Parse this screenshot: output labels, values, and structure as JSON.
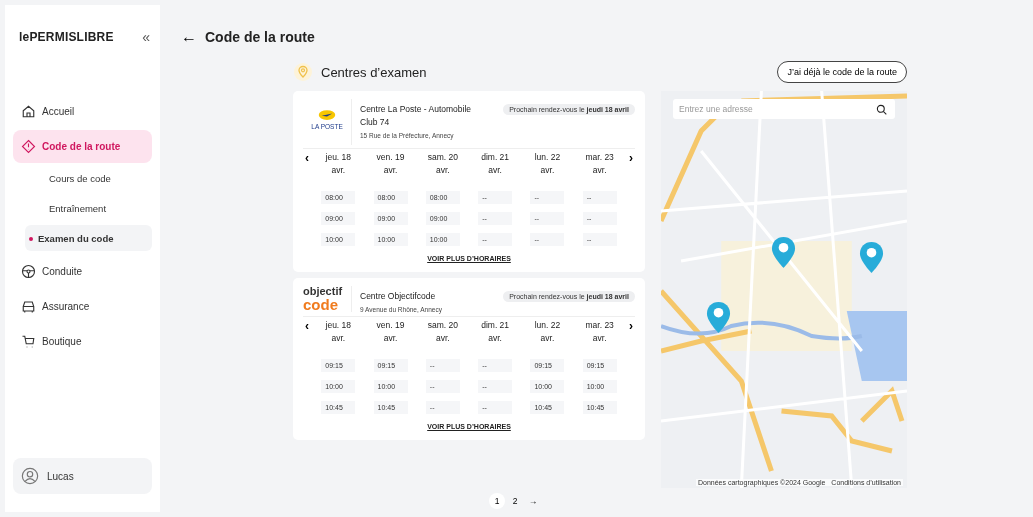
{
  "brand": {
    "logo": "lePERMISLIBRE",
    "collapse": "«"
  },
  "nav": [
    {
      "label": "Accueil",
      "selected": false
    },
    {
      "label": "Code de la route",
      "selected": true,
      "children": [
        {
          "label": "Cours de code",
          "selected": false
        },
        {
          "label": "Entraînement",
          "selected": false
        },
        {
          "label": "Examen du code",
          "selected": true
        }
      ]
    },
    {
      "label": "Conduite",
      "selected": false
    },
    {
      "label": "Assurance",
      "selected": false
    },
    {
      "label": "Boutique",
      "selected": false
    }
  ],
  "user": {
    "name": "Lucas"
  },
  "page": {
    "back": "←",
    "title": "Code de la route"
  },
  "section": {
    "title": "Centres d’examen",
    "action": "J’ai déjà le code de la route"
  },
  "centers": [
    {
      "kind": "poste",
      "logo_text": "LA POSTE",
      "name": "Centre La Poste - Automobile Club 74",
      "address": "15 Rue de la Préfecture, Annecy",
      "next": "Prochain rendez-vous le **jeudi 18 avril**",
      "prev": "‹",
      "nextArrow": "›",
      "days": [
        {
          "label": "jeu. 18 avr.",
          "slots": [
            "08:00",
            "09:00",
            "10:00"
          ]
        },
        {
          "label": "ven. 19 avr.",
          "slots": [
            "08:00",
            "09:00",
            "10:00"
          ]
        },
        {
          "label": "sam. 20 avr.",
          "slots": [
            "08:00",
            "09:00",
            "10:00"
          ]
        },
        {
          "label": "dim. 21 avr.",
          "slots": [
            "--",
            "--",
            "--"
          ]
        },
        {
          "label": "lun. 22 avr.",
          "slots": [
            "--",
            "--",
            "--"
          ]
        },
        {
          "label": "mar. 23 avr.",
          "slots": [
            "--",
            "--",
            "--"
          ]
        }
      ],
      "more": "VOIR PLUS D’HORAIRES"
    },
    {
      "kind": "objectif",
      "logo_text": "objectif",
      "logo_text2": "code",
      "name": "Centre Objectifcode",
      "address": "9 Avenue du Rhône, Annecy",
      "next": "Prochain rendez-vous le **jeudi 18 avril**",
      "prev": "‹",
      "nextArrow": "›",
      "days": [
        {
          "label": "jeu. 18 avr.",
          "slots": [
            "09:15",
            "10:00",
            "10:45"
          ]
        },
        {
          "label": "ven. 19 avr.",
          "slots": [
            "09:15",
            "10:00",
            "10:45"
          ]
        },
        {
          "label": "sam. 20 avr.",
          "slots": [
            "--",
            "--",
            "--"
          ]
        },
        {
          "label": "dim. 21 avr.",
          "slots": [
            "--",
            "--",
            "--"
          ]
        },
        {
          "label": "lun. 22 avr.",
          "slots": [
            "09:15",
            "10:00",
            "10:45"
          ]
        },
        {
          "label": "mar. 23 avr.",
          "slots": [
            "09:15",
            "10:00",
            "10:45"
          ]
        }
      ],
      "more": "VOIR PLUS D’HORAIRES"
    }
  ],
  "map": {
    "placeholder": "Entrez une adresse",
    "attribution": "Données cartographiques ©2024 Google",
    "terms": "Conditions d’utilisation"
  },
  "pagination": {
    "pages": [
      {
        "label": "1",
        "selected": true
      },
      {
        "label": "2",
        "selected": false
      }
    ],
    "next": "→"
  }
}
